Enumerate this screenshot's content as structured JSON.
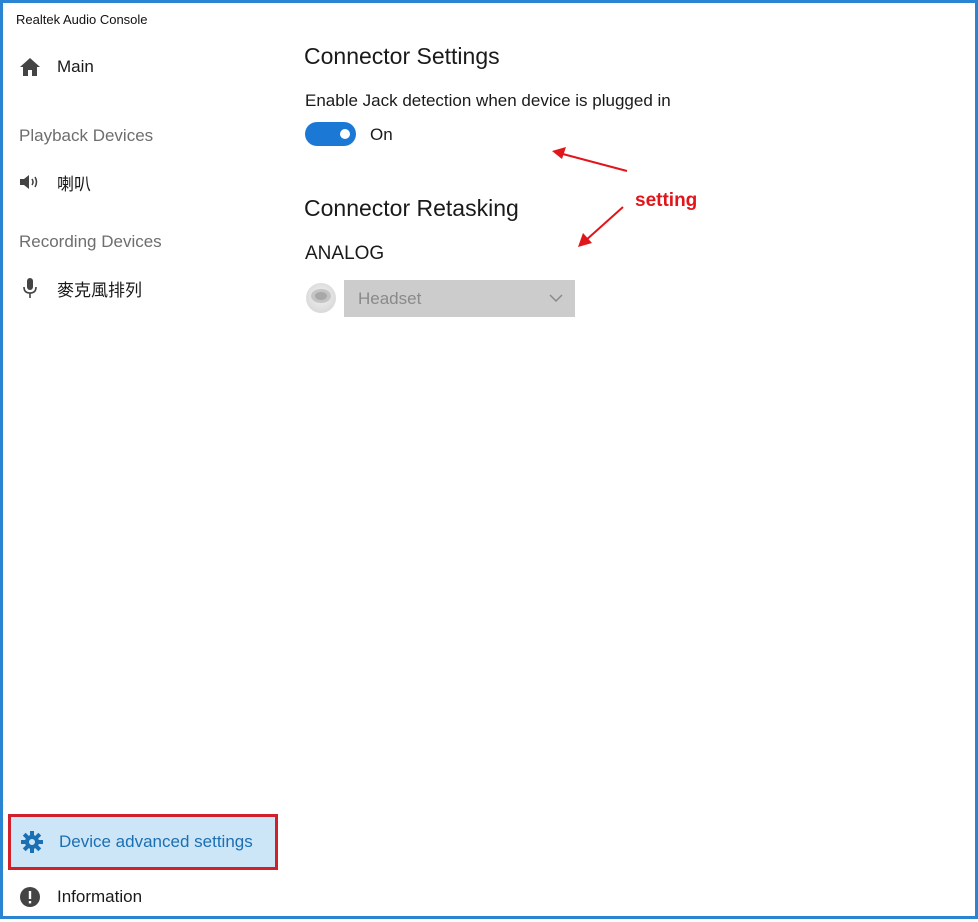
{
  "window": {
    "title": "Realtek Audio Console"
  },
  "sidebar": {
    "main_label": "Main",
    "playback_section": "Playback Devices",
    "playback_device": "喇叭",
    "recording_section": "Recording Devices",
    "recording_device": "麥克風排列",
    "advanced_label": "Device advanced settings",
    "information_label": "Information",
    "icons": {
      "main": "home-icon",
      "playback_device": "speaker-icon",
      "recording_device": "microphone-icon",
      "advanced": "gear-icon",
      "information": "info-icon"
    }
  },
  "content": {
    "connector_settings_heading": "Connector Settings",
    "jack_detection_label": "Enable Jack detection when device is plugged in",
    "toggle_state": "On",
    "connector_retasking_heading": "Connector Retasking",
    "analog_label": "ANALOG",
    "retask_dropdown_value": "Headset"
  },
  "annotations": {
    "callout_text": "setting"
  },
  "colors": {
    "accent": "#1b78d4",
    "selected_bg": "#cde6f7",
    "highlight_border": "#d0202a",
    "annotation": "#e0161b",
    "window_border": "#2a84d2"
  }
}
